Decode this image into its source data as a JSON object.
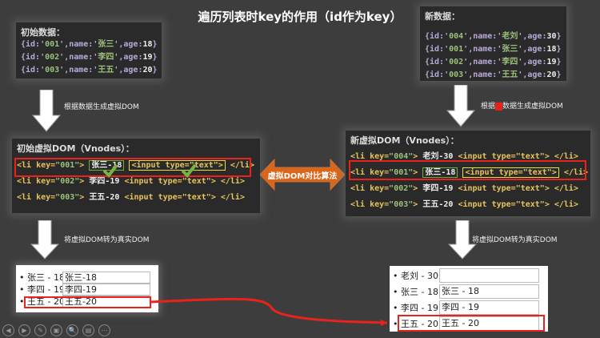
{
  "title": "遍历列表时key的作用（id作为key）",
  "initial_data": {
    "label": "初始数据：",
    "items": [
      {
        "id": "001",
        "name": "张三",
        "age": "18"
      },
      {
        "id": "002",
        "name": "李四",
        "age": "19"
      },
      {
        "id": "003",
        "name": "王五",
        "age": "20"
      }
    ]
  },
  "new_data": {
    "label": "新数据：",
    "items": [
      {
        "id": "004",
        "name": "老刘",
        "age": "30"
      },
      {
        "id": "001",
        "name": "张三",
        "age": "18"
      },
      {
        "id": "002",
        "name": "李四",
        "age": "19"
      },
      {
        "id": "003",
        "name": "王五",
        "age": "20"
      }
    ]
  },
  "arrows": {
    "gen_left": "根据数据生成虚拟DOM",
    "gen_right_pre": "根据",
    "gen_right_mid": "新",
    "gen_right_post": "数据生成虚拟DOM",
    "to_real_left": "将虚拟DOM转为真实DOM",
    "to_real_right": "将虚拟DOM转为真实DOM",
    "diff": "虚拟DOM对比算法"
  },
  "initial_vdom": {
    "label": "初始虚拟DOM（Vnodes）：",
    "rows": [
      {
        "key": "001",
        "text": "张三-18"
      },
      {
        "key": "002",
        "text": "李四-19"
      },
      {
        "key": "003",
        "text": "王五-20"
      }
    ]
  },
  "new_vdom": {
    "label": "新虚拟DOM（Vnodes）：",
    "rows": [
      {
        "key": "004",
        "text": "老刘-30"
      },
      {
        "key": "001",
        "text": "张三-18"
      },
      {
        "key": "002",
        "text": "李四-19"
      },
      {
        "key": "003",
        "text": "王五-20"
      }
    ]
  },
  "code": {
    "li_open": "<li key=",
    "close": ">",
    "input": "<input type=\"text\">",
    "li_close": "</li>"
  },
  "real_left": [
    {
      "label": "张三 - 18",
      "value": "张三-18"
    },
    {
      "label": "李四 - 19",
      "value": "李四-19"
    },
    {
      "label": "王五 - 20",
      "value": "王五-20"
    }
  ],
  "real_right": [
    {
      "label": "老刘 - 30",
      "value": ""
    },
    {
      "label": "张三 - 18",
      "value": "张三 - 18"
    },
    {
      "label": "李四 - 19",
      "value": "李四 - 19"
    },
    {
      "label": "王五 - 20",
      "value": "王五 - 20"
    }
  ],
  "toolbar": [
    "◀",
    "▶",
    "✎",
    "▣",
    "🔍",
    "▤",
    "⋯"
  ],
  "colors": {
    "highlight": "#e8231b",
    "arrow": "#d9661a",
    "check": "#7ab342"
  }
}
